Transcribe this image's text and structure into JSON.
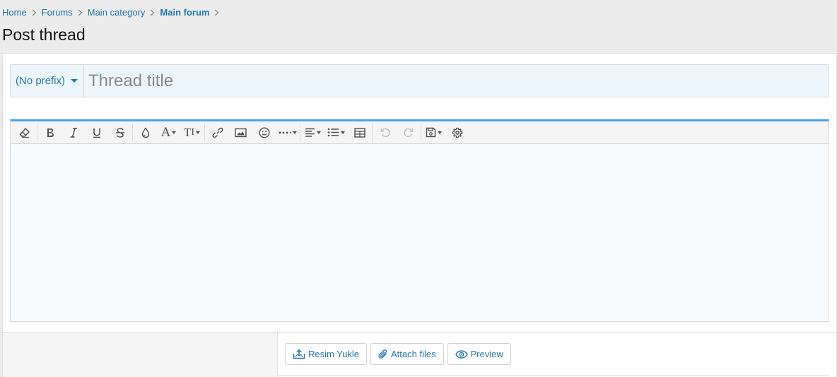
{
  "breadcrumb": {
    "items": [
      "Home",
      "Forums",
      "Main category"
    ],
    "current": "Main forum"
  },
  "page": {
    "title": "Post thread"
  },
  "thread_form": {
    "prefix_label": "(No prefix)",
    "title_placeholder": "Thread title",
    "title_value": ""
  },
  "editor": {
    "toolbar_icons": [
      "remove-format-icon",
      "bold-icon",
      "italic-icon",
      "underline-icon",
      "strikethrough-icon",
      "text-color-icon",
      "font-family-icon",
      "font-size-icon",
      "insert-link-icon",
      "insert-image-icon",
      "emoji-icon",
      "more-options-icon",
      "align-icon",
      "list-icon",
      "table-icon",
      "undo-icon",
      "redo-icon",
      "drafts-icon",
      "settings-icon"
    ],
    "accent_color": "#47a7eb",
    "body_bg": "#f7fbfe"
  },
  "actions": {
    "upload_image_label": "Resim Yukle",
    "attach_files_label": "Attach files",
    "preview_label": "Preview"
  },
  "colors": {
    "link": "#2577b1",
    "page_bg": "#ececec",
    "title_bar_bg": "#edf6fd"
  }
}
